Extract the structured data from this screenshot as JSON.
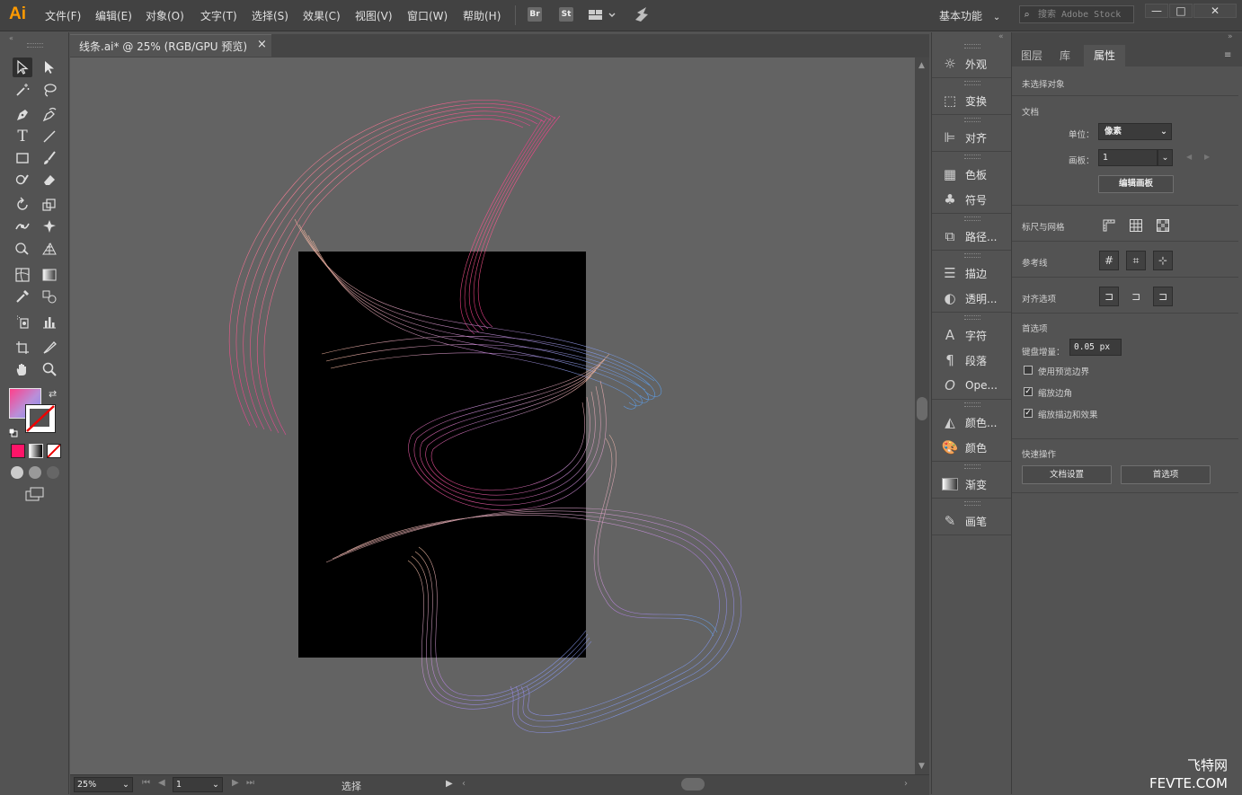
{
  "app": {
    "logo": "Ai"
  },
  "menu": [
    "文件(F)",
    "编辑(E)",
    "对象(O)",
    "文字(T)",
    "选择(S)",
    "效果(C)",
    "视图(V)",
    "窗口(W)",
    "帮助(H)"
  ],
  "menubar_icons": {
    "bridge": "Br",
    "stock": "St"
  },
  "workspace": {
    "label": "基本功能"
  },
  "stock_search": {
    "placeholder": "搜索 Adobe Stock"
  },
  "window_controls": {
    "minimize": "—",
    "restore": "□",
    "close": "✕"
  },
  "document": {
    "tab_title": "线条.ai* @ 25% (RGB/GPU 预览)",
    "close_glyph": "×"
  },
  "status": {
    "zoom": "25%",
    "artboard": "1",
    "tool": "选择"
  },
  "dock": [
    "外观",
    "变换",
    "对齐",
    "色板",
    "符号",
    "路径...",
    "描边",
    "透明...",
    "字符",
    "段落",
    "Ope...",
    "颜色...",
    "颜色",
    "渐变",
    "画笔"
  ],
  "properties": {
    "tabs": [
      "图层",
      "库",
      "属性"
    ],
    "active_tab": "属性",
    "no_selection": "未选择对象",
    "document_section": "文档",
    "unit_label": "单位：",
    "unit_value": "像素",
    "artboard_label": "画板：",
    "artboard_value": "1",
    "edit_artboards": "编辑画板",
    "rulers_grid": "标尺与网格",
    "guides": "参考线",
    "snap_options": "对齐选项",
    "preferences": "首选项",
    "keyboard_increment_label": "键盘增量：",
    "keyboard_increment_value": "0.05 px",
    "use_preview_bounds": "使用预览边界",
    "use_preview_bounds_checked": false,
    "scale_corners": "缩放边角",
    "scale_corners_checked": true,
    "scale_strokes": "缩放描边和效果",
    "scale_strokes_checked": true,
    "quick_actions": "快速操作",
    "doc_setup": "文档设置",
    "prefs_button": "首选项"
  },
  "colors": {
    "accent_orange": "#ff9a00",
    "canvas": "#636363",
    "artboard": "#000000",
    "wave_pink": "#ff3f8a",
    "wave_peach": "#f7b899",
    "wave_blue": "#5aa0ee"
  },
  "watermark": {
    "line1": "飞特网",
    "line2": "FEVTE.COM"
  }
}
